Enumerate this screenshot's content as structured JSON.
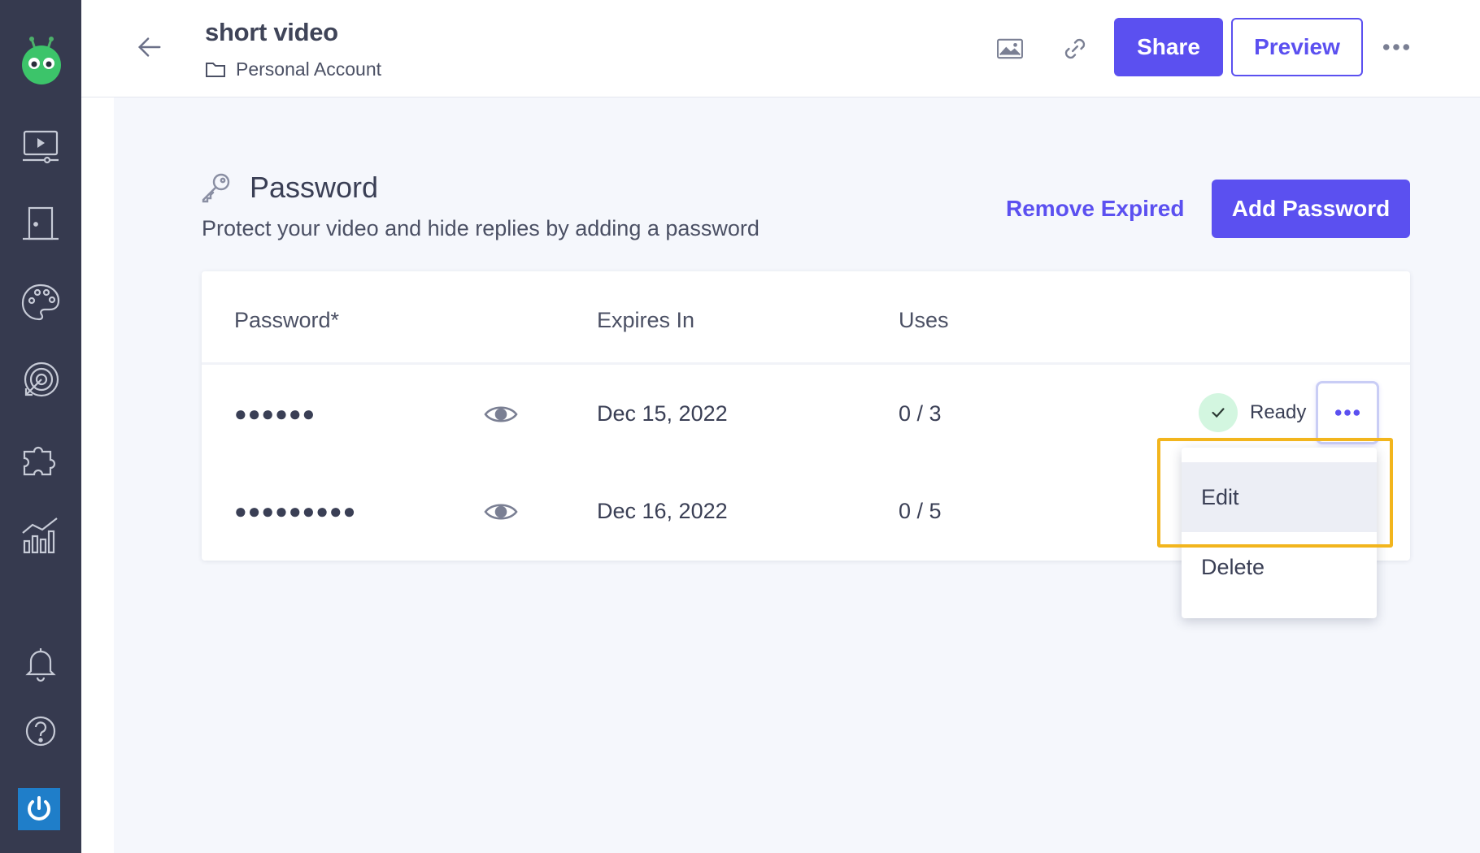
{
  "sidebar": {
    "icons": [
      "robot-logo-icon",
      "video-icon",
      "door-icon",
      "palette-icon",
      "target-icon",
      "puzzle-icon",
      "chart-icon",
      "bell-icon",
      "help-icon",
      "power-icon"
    ]
  },
  "header": {
    "title": "short video",
    "breadcrumb": "Personal Account",
    "share_label": "Share",
    "preview_label": "Preview"
  },
  "section": {
    "title": "Password",
    "subtitle": "Protect your video and hide replies by adding a password",
    "remove_expired_label": "Remove Expired",
    "add_password_label": "Add Password"
  },
  "table": {
    "columns": [
      "Password*",
      "Expires In",
      "Uses"
    ],
    "rows": [
      {
        "password": "●●●●●●",
        "expires": "Dec 15, 2022",
        "uses": "0 / 3",
        "status": "Ready"
      },
      {
        "password": "●●●●●●●●●",
        "expires": "Dec 16, 2022",
        "uses": "0 / 5",
        "status": ""
      }
    ]
  },
  "menu": {
    "items": [
      "Edit",
      "Delete"
    ]
  },
  "colors": {
    "accent": "#5b50f0",
    "sidebar": "#363a4f",
    "highlight": "#f2b51d",
    "ready": "#d3f6e0"
  }
}
